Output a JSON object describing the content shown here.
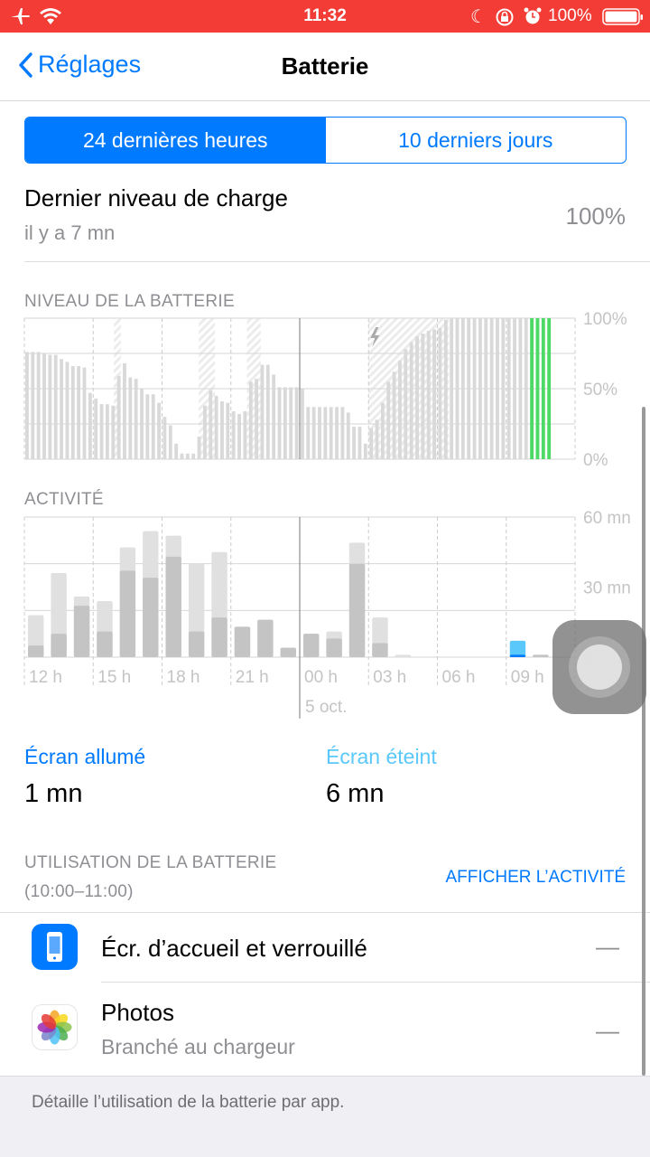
{
  "status_bar": {
    "time": "11:32",
    "battery": "100%",
    "icons": [
      "airplane-icon",
      "wifi-icon",
      "moon-icon",
      "rotation-lock-icon",
      "alarm-icon",
      "battery-icon"
    ]
  },
  "nav": {
    "back_label": "Réglages",
    "title": "Batterie"
  },
  "segments": [
    {
      "label": "24 dernières heures",
      "selected": true
    },
    {
      "label": "10 derniers jours",
      "selected": false
    }
  ],
  "last_charge": {
    "label": "Dernier niveau de charge",
    "time": "il y a 7 mn",
    "value": "100%"
  },
  "colors": {
    "accent": "#007aff",
    "status_bar": "#f23c35",
    "charging_green": "#4cd964",
    "screen_on": "#5ac8fa",
    "screen_off": "#007aff"
  },
  "chart_data": [
    {
      "type": "bar",
      "title": "NIVEAU DE LA BATTERIE",
      "y_ticks": [
        "100%",
        "50%",
        "0%"
      ],
      "ylim": [
        0,
        100
      ],
      "x_range_hours": [
        12,
        36
      ],
      "interval_minutes": 15,
      "values": [
        76,
        76,
        76,
        75,
        74,
        74,
        71,
        69,
        66,
        66,
        65,
        47,
        43,
        39,
        39,
        38,
        59,
        68,
        58,
        57,
        50,
        46,
        46,
        40,
        30,
        24,
        11,
        4,
        4,
        4,
        16,
        38,
        49,
        45,
        41,
        40,
        34,
        32,
        34,
        55,
        57,
        67,
        67,
        60,
        51,
        51,
        51,
        51,
        50,
        37,
        37,
        37,
        37,
        37,
        37,
        37,
        33,
        23,
        23,
        11,
        22,
        28,
        40,
        55,
        62,
        70,
        78,
        83,
        87,
        89,
        91,
        92,
        93,
        99,
        100,
        100,
        100,
        100,
        100,
        100,
        100,
        100,
        100,
        100,
        100,
        100,
        100,
        100,
        100,
        100,
        100,
        100
      ],
      "charging_periods_hours": [
        [
          15.9,
          16.2
        ],
        [
          19.6,
          20.3
        ],
        [
          21.7,
          22.3
        ],
        [
          27,
          30.5
        ]
      ],
      "highlight_hour": [
        34,
        35
      ]
    },
    {
      "type": "bar",
      "title": "ACTIVITÉ",
      "y_ticks": [
        "60 mn",
        "30 mn",
        "0 mn"
      ],
      "ylim": [
        0,
        60
      ],
      "x_tick_labels": [
        "12 h",
        "15 h",
        "18 h",
        "21 h",
        "00 h",
        "03 h",
        "06 h",
        "09 h"
      ],
      "date_label": "5 oct.",
      "categories": [
        "12",
        "13",
        "14",
        "15",
        "16",
        "17",
        "18",
        "19",
        "20",
        "21",
        "22",
        "23",
        "00",
        "01",
        "02",
        "03",
        "04",
        "05",
        "06",
        "07",
        "08",
        "09",
        "10",
        "11"
      ],
      "series": [
        {
          "name": "Écran allumé",
          "values": [
            5,
            10,
            22,
            11,
            37,
            34,
            43,
            11,
            17,
            13,
            16,
            4,
            10,
            8,
            40,
            6,
            0,
            0,
            0,
            0,
            0,
            1,
            1,
            0
          ]
        },
        {
          "name": "Écran éteint",
          "values": [
            13,
            26,
            4,
            13,
            10,
            20,
            9,
            29,
            28,
            0,
            0,
            0,
            0,
            3,
            9,
            11,
            1,
            0,
            0,
            0,
            0,
            6,
            0,
            0
          ]
        }
      ],
      "highlight_index": 21
    }
  ],
  "screen": {
    "on_label": "Écran allumé",
    "on_value": "1 mn",
    "off_label": "Écran éteint",
    "off_value": "6 mn"
  },
  "usage": {
    "title": "UTILISATION DE LA BATTERIE",
    "range": "(10:00–11:00)",
    "show_activity": "AFFICHER L’ACTIVITÉ",
    "apps": [
      {
        "name": "Écr. d’accueil et verrouillé",
        "sub": "",
        "value": "—",
        "icon": "home-lock-screen-icon"
      },
      {
        "name": "Photos",
        "sub": "Branché au chargeur",
        "value": "—",
        "icon": "photos-icon"
      }
    ],
    "footer": "Détaille l’utilisation de la batterie par app."
  }
}
